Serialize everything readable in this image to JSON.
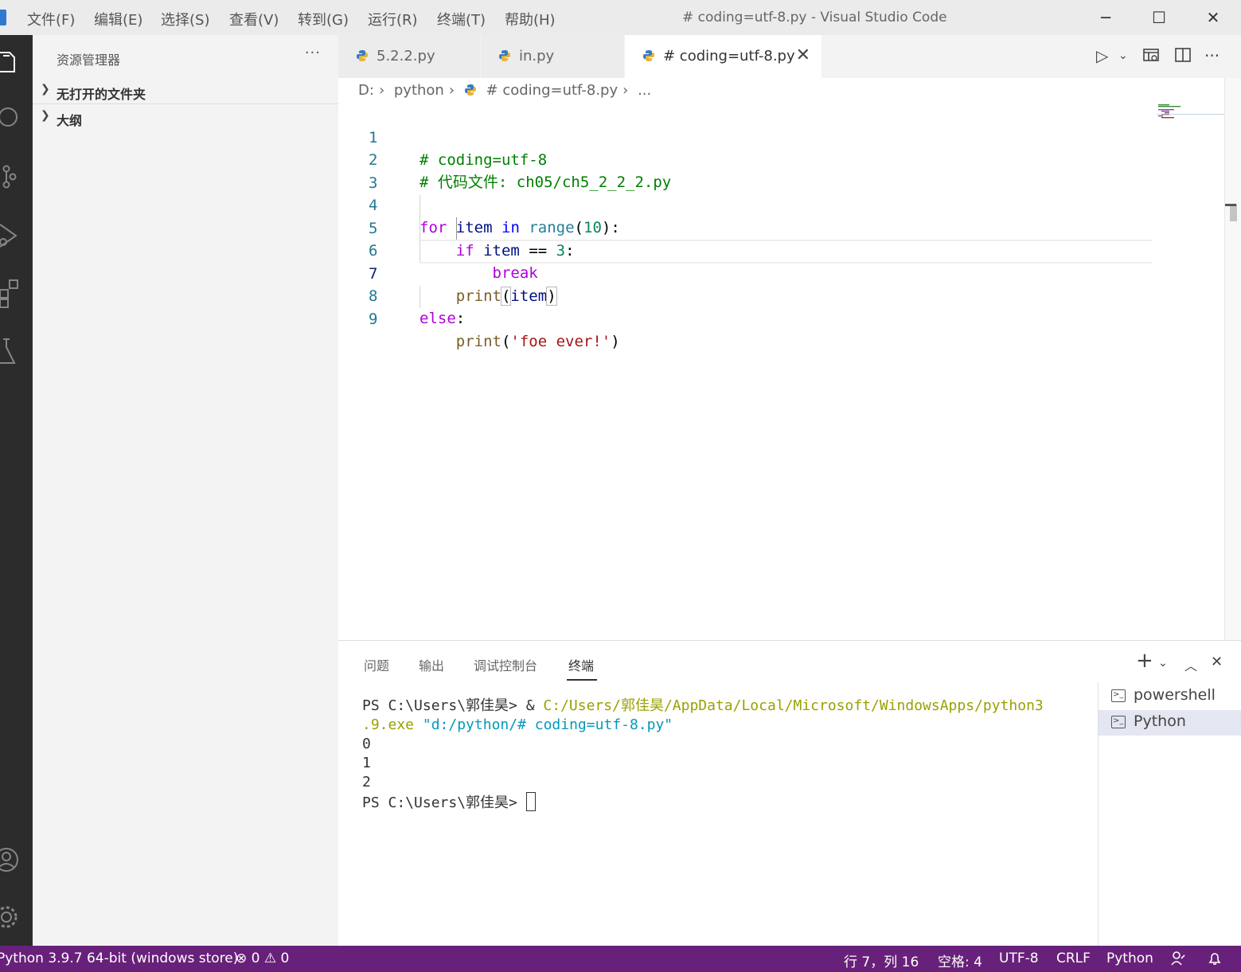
{
  "window": {
    "title": "# coding=utf-8.py - Visual Studio Code",
    "menu": [
      "文件(F)",
      "编辑(E)",
      "选择(S)",
      "查看(V)",
      "转到(G)",
      "运行(R)",
      "终端(T)",
      "帮助(H)"
    ],
    "controls": {
      "minimize": "─",
      "maximize": "☐",
      "close": "✕"
    }
  },
  "activity_bar": {
    "icons": [
      "explorer-icon",
      "search-icon",
      "source-control-icon",
      "run-debug-icon",
      "extensions-icon",
      "testing-icon",
      "accounts-icon",
      "manage-gear-icon"
    ]
  },
  "sidebar": {
    "title": "资源管理器",
    "more": "···",
    "sections": [
      {
        "label": "无打开的文件夹"
      },
      {
        "label": "大纲"
      }
    ]
  },
  "tabs": [
    {
      "label": "5.2.2.py",
      "active": false
    },
    {
      "label": "in.py",
      "active": false
    },
    {
      "label": "# coding=utf-8.py",
      "active": true,
      "close": "✕"
    }
  ],
  "breadcrumb": {
    "drive": "D:",
    "folder": "python",
    "file": "# coding=utf-8.py",
    "more": "..."
  },
  "editor": {
    "line_numbers": [
      "1",
      "2",
      "3",
      "4",
      "5",
      "6",
      "7",
      "8",
      "9"
    ]
  },
  "panel": {
    "tabs": [
      "问题",
      "输出",
      "调试控制台",
      "终端"
    ],
    "active_tab": "终端",
    "terminal": {
      "line1_prompt": "PS C:\\Users\\郭佳昊> ",
      "line1_amp": "& ",
      "line1_path": "C:/Users/郭佳昊/AppData/Local/Microsoft/WindowsApps/python3",
      "line2_path": ".9.exe",
      "line2_arg": " \"d:/python/# coding=utf-8.py\"",
      "outputs": [
        "0",
        "1",
        "2"
      ],
      "final_prompt": "PS C:\\Users\\郭佳昊> "
    },
    "terminal_list": [
      {
        "label": "powershell",
        "selected": false
      },
      {
        "label": "Python",
        "selected": true
      }
    ]
  },
  "status_bar": {
    "interpreter": "Python 3.9.7 64-bit (windows store)",
    "errors": "0",
    "warnings": "0",
    "position": "行 7，列 16",
    "spaces": "空格: 4",
    "encoding": "UTF-8",
    "eol": "CRLF",
    "language": "Python",
    "color": "#68217a"
  }
}
